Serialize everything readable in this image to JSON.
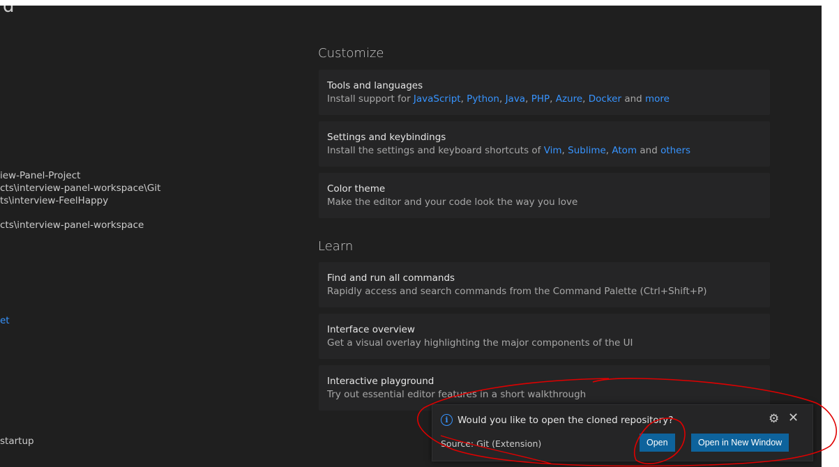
{
  "left_panel": {
    "heading_fragment": "d",
    "recent_line_1": "iew-Panel-Project",
    "recent_line_2": "cts\\interview-panel-workspace\\Git",
    "recent_line_3": "ts\\interview-FeelHappy",
    "recent_line_4": "cts\\interview-panel-workspace",
    "link_fragment": "et",
    "startup_fragment": "startup"
  },
  "customize": {
    "title": "Customize",
    "tools": {
      "title": "Tools and languages",
      "desc_prefix": "Install support for ",
      "links": [
        "JavaScript",
        "Python",
        "Java",
        "PHP",
        "Azure",
        "Docker",
        "more"
      ],
      "sep": ", ",
      "and": " and "
    },
    "settings": {
      "title": "Settings and keybindings",
      "desc_prefix": "Install the settings and keyboard shortcuts of ",
      "links": [
        "Vim",
        "Sublime",
        "Atom",
        "others"
      ],
      "and": " and "
    },
    "theme": {
      "title": "Color theme",
      "desc": "Make the editor and your code look the way you love"
    }
  },
  "learn": {
    "title": "Learn",
    "commands": {
      "title": "Find and run all commands",
      "desc": "Rapidly access and search commands from the Command Palette (Ctrl+Shift+P)"
    },
    "overview": {
      "title": "Interface overview",
      "desc": "Get a visual overlay highlighting the major components of the UI"
    },
    "playground": {
      "title": "Interactive playground",
      "desc": "Try out essential editor features in a short walkthrough"
    }
  },
  "notification": {
    "icon": "info-icon",
    "message": "Would you like to open the cloned repository?",
    "source": "Source: Git (Extension)",
    "open_label": "Open",
    "open_new_window_label": "Open in New Window",
    "gear_icon": "gear-icon",
    "close_icon": "close-icon"
  },
  "colors": {
    "background": "#1f1f1f",
    "card": "#252526",
    "link": "#3794ff",
    "button": "#0e639c",
    "annotation": "#e00000"
  }
}
